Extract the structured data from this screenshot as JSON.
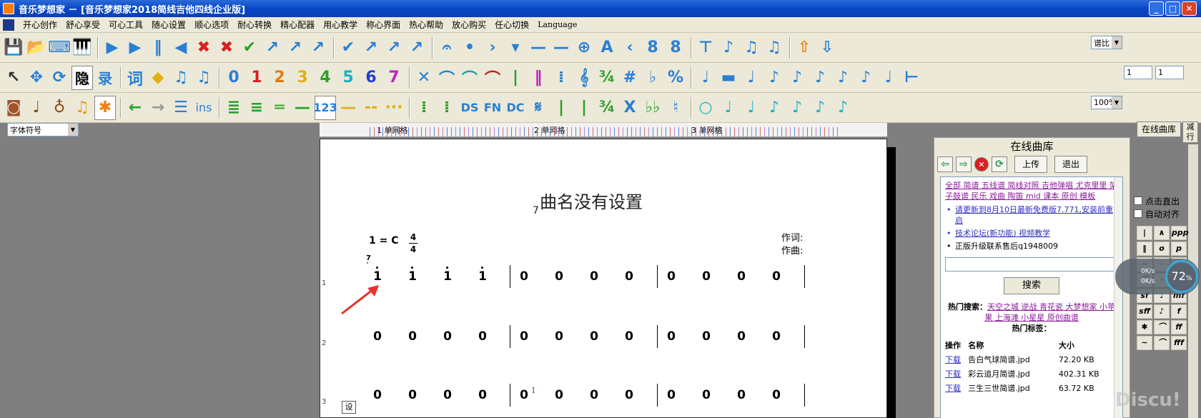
{
  "window": {
    "title": "音乐梦想家 － [音乐梦想家2018简线吉他四线企业版]"
  },
  "menu": [
    "开心创作",
    "舒心享受",
    "可心工具",
    "随心设置",
    "顺心选项",
    "耐心转换",
    "精心配器",
    "用心教学",
    "称心界面",
    "热心帮助",
    "放心购买",
    "任心切换",
    "Language"
  ],
  "toolbar1": {
    "icons": [
      "save-icon",
      "open-folder-icon",
      "keyboard-icon",
      "piano-icon",
      "play-icon",
      "play-selection-icon",
      "pause-icon",
      "rewind-icon",
      "stop-icon",
      "delete-icon",
      "check-icon",
      "arrow-tool-icon",
      "arrow-tool-icon",
      "arrow-tool-icon",
      "spell-check-icon",
      "arrow-tool-icon",
      "arrow-tool-icon",
      "arrow-tool-icon",
      "fermata-icon",
      "dot-icon",
      "accent-icon",
      "down-icon",
      "tenuto-icon",
      "line-icon",
      "crosshair-icon",
      "text-a-icon",
      "less-than-icon",
      "add-icon",
      "remove-icon",
      "beam-icon",
      "note-icon",
      "notes-icon",
      "notes-icon",
      "upload-icon",
      "download-icon"
    ],
    "compare_select": "谱比"
  },
  "toolbar2": {
    "digits": [
      "0",
      "1",
      "2",
      "3",
      "4",
      "5",
      "6",
      "7"
    ],
    "digit_colors": [
      "#2a7fd4",
      "#d62020",
      "#e07a10",
      "#e0b010",
      "#2aa02a",
      "#18b0c8",
      "#2040d0",
      "#c020c0"
    ],
    "hide_label": "隐",
    "record_label": "录",
    "sharp": "#",
    "flat": "♭",
    "percent": "%",
    "input1": "1",
    "input2": "1"
  },
  "toolbar3": {
    "ins": "ins",
    "num_label": "123",
    "ds": "DS",
    "fn": "FN",
    "dc": "DC",
    "x": "X",
    "zoom": "100%"
  },
  "font_select": "字体符号",
  "ruler": {
    "labels": [
      "1 单网格",
      "2 单网格",
      "3 单网格"
    ]
  },
  "score": {
    "title": "曲名没有设置",
    "title_mark": "7",
    "key": "1 = C",
    "meter_top": "4",
    "meter_bottom": "4",
    "lyricist": "作词:",
    "composer": "作曲:",
    "grace_top": "7",
    "grace_bottom": "ʿ",
    "rows": [
      {
        "num": "1",
        "notes": [
          "1",
          "1",
          "1",
          "1",
          "0",
          "0",
          "0",
          "0",
          "0",
          "0",
          "0",
          "0"
        ]
      },
      {
        "num": "2",
        "notes": [
          "0",
          "0",
          "0",
          "0",
          "0",
          "0",
          "0",
          "0",
          "0",
          "0",
          "0",
          "0"
        ]
      },
      {
        "num": "3",
        "notes": [
          "0",
          "0",
          "0",
          "0",
          "0",
          "0",
          "0",
          "0",
          "0",
          "0",
          "0",
          "0"
        ]
      }
    ],
    "cursor": "I",
    "set_label": "设"
  },
  "panel": {
    "title": "在线曲库",
    "upload": "上传",
    "logout": "退出",
    "categories": "全部 简谱 五线谱 简线对照 吉他弹唱 尤克里里 架子鼓谱 民乐 戏曲 陶笛 mid 课本 原创 模板",
    "bullets": [
      "请更新到8月10日最新免费版7.771,安装前重启",
      "技术论坛(新功能) 视频教学",
      "正版升级联系售后q1948009"
    ],
    "search_button": "搜索",
    "hot_search_label": "热门搜索：",
    "hot_search": "天空之城 逆战 青花瓷 大梦想家 小苹果 上海滩 小星星 原创曲谱",
    "hot_tags_label": "热门标签：",
    "table_headers": [
      "操作",
      "名称",
      "大小"
    ],
    "files": [
      {
        "action": "下载",
        "name": "告白气球简谱.jpd",
        "size": "72.20 KB"
      },
      {
        "action": "下载",
        "name": "彩云追月简谱.jpd",
        "size": "402.31 KB"
      },
      {
        "action": "下载",
        "name": "三生三世简谱.jpd",
        "size": "63.72 KB"
      }
    ]
  },
  "library_tab": "在线曲库",
  "side_tab": "减行",
  "right_panel": {
    "snap_label": "点击直出",
    "auto_align_label": "自动对齐",
    "dynamics": [
      "ppp",
      "mf",
      "f",
      "ff",
      "fff",
      "sf",
      "sff"
    ]
  },
  "speed": {
    "up": "0K/s",
    "down": "0K/s",
    "percent": "72"
  },
  "watermark": "Discu!"
}
